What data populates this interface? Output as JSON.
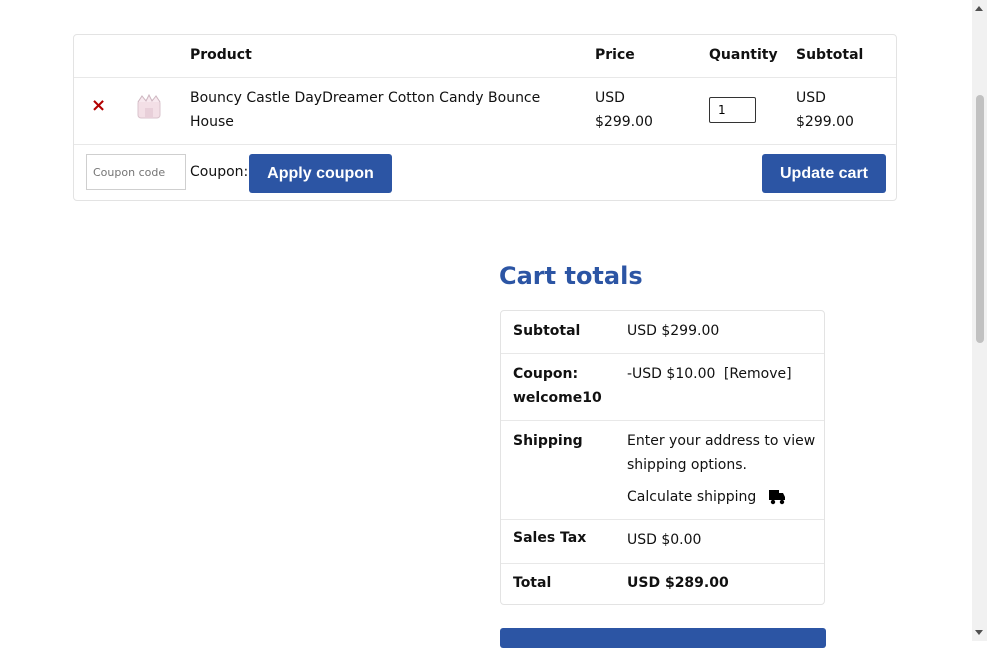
{
  "cart": {
    "headers": {
      "product": "Product",
      "price": "Price",
      "quantity": "Quantity",
      "subtotal": "Subtotal"
    },
    "items": [
      {
        "name_line1": "Bouncy Castle DayDreamer Cotton Candy Bounce",
        "name_line2": "House",
        "price_currency": "USD",
        "price_amount": "$299.00",
        "quantity": "1",
        "subtotal_currency": "USD",
        "subtotal_amount": "$299.00"
      }
    ],
    "coupon_placeholder": "Coupon code",
    "coupon_label": "Coupon:",
    "apply_coupon_label": "Apply coupon",
    "update_cart_label": "Update cart"
  },
  "totals": {
    "title": "Cart totals",
    "subtotal_label": "Subtotal",
    "subtotal_value": "USD $299.00",
    "coupon_label_line1": "Coupon:",
    "coupon_label_line2": "welcome10",
    "coupon_value": "-USD $10.00",
    "coupon_remove": "[Remove]",
    "shipping_label": "Shipping",
    "shipping_text_line1": "Enter your address to view",
    "shipping_text_line2": "shipping options.",
    "calculate_shipping": "Calculate shipping",
    "tax_label": "Sales Tax",
    "tax_value": "USD $0.00",
    "total_label": "Total",
    "total_value": "USD $289.00"
  },
  "colors": {
    "accent": "#2c55a4",
    "remove": "#b30000"
  },
  "icons": {
    "remove": "close-icon",
    "shipping": "truck-icon",
    "product": "bounce-house-thumbnail"
  }
}
